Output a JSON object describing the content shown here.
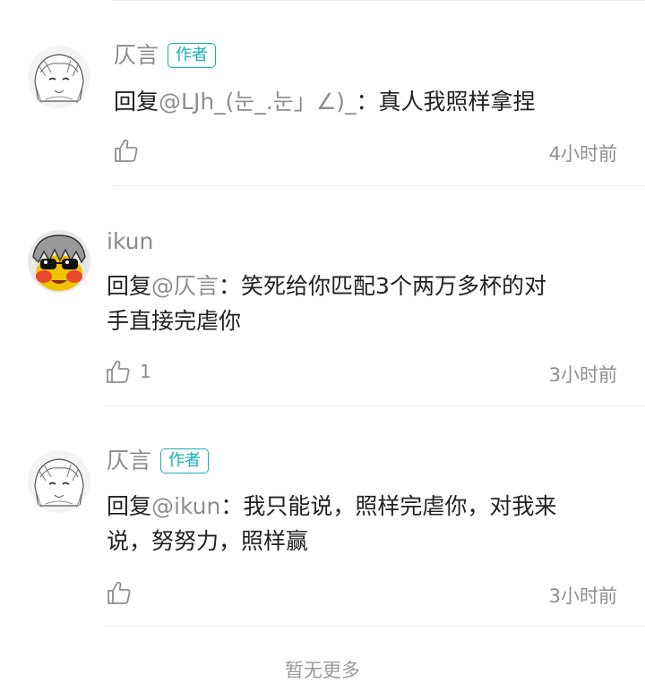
{
  "comments": [
    {
      "author": "仄言",
      "badge": "作者",
      "reply_prefix": "回复",
      "mention": "@LJh_(눈_.눈」∠)_",
      "separator": "：",
      "text": "真人我照样拿捏",
      "likes": "",
      "time": "4小时前",
      "avatar": "anime-girl-sketch"
    },
    {
      "author": "ikun",
      "badge": "",
      "reply_prefix": "回复",
      "mention": "@仄言",
      "separator": "：",
      "text_line1": "笑死给你匹配3个两万多杯的对",
      "text_line2": "手直接完虐你",
      "likes": "1",
      "time": "3小时前",
      "avatar": "cartoon-grey-hair-sunglasses"
    },
    {
      "author": "仄言",
      "badge": "作者",
      "reply_prefix": "回复",
      "mention": "@ikun",
      "separator": "：",
      "text_line1": "我只能说，照样完虐你，对我来",
      "text_line2": "说，努努力，照样赢",
      "likes": "",
      "time": "3小时前",
      "avatar": "anime-girl-sketch"
    }
  ],
  "footer": {
    "no_more": "暂无更多"
  },
  "colors": {
    "badge": "#17b0b4",
    "text": "#222222",
    "muted": "#8f8f8f",
    "divider": "#ececec"
  }
}
